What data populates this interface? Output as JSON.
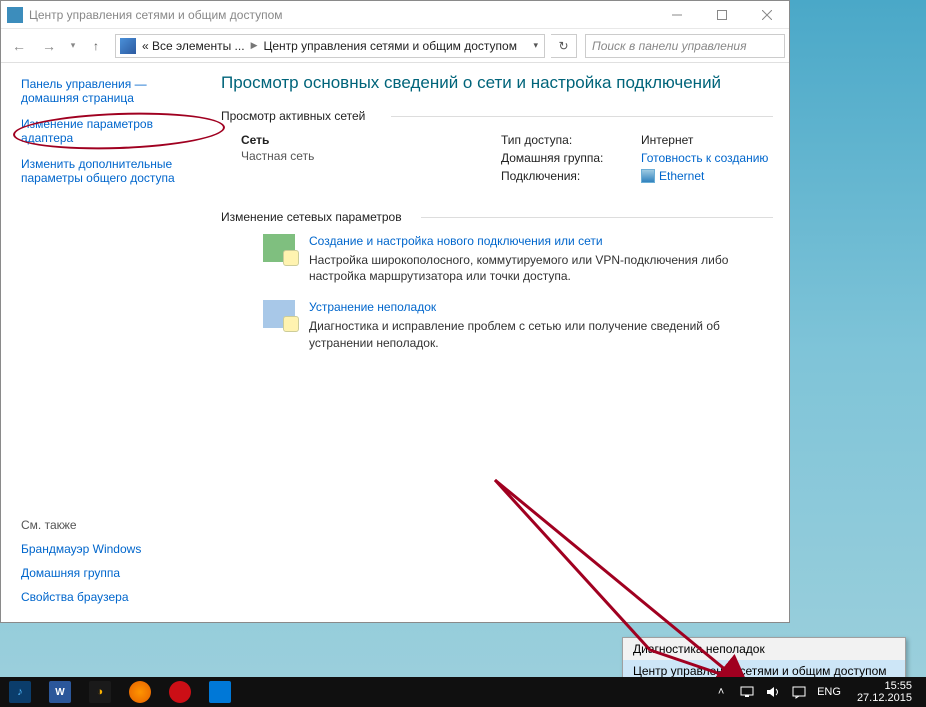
{
  "window": {
    "title": "Центр управления сетями и общим доступом"
  },
  "nav": {
    "seg1": "« Все элементы ...",
    "seg2": "Центр управления сетями и общим доступом",
    "search_placeholder": "Поиск в панели управления"
  },
  "sidebar": {
    "home": "Панель управления — домашняя страница",
    "adapter": "Изменение параметров адаптера",
    "sharing": "Изменить дополнительные параметры общего доступа",
    "seealso_h": "См. также",
    "seealso": {
      "firewall": "Брандмауэр Windows",
      "homegroup": "Домашняя группа",
      "browser": "Свойства браузера"
    }
  },
  "main": {
    "heading": "Просмотр основных сведений о сети и настройка подключений",
    "active_title": "Просмотр активных сетей",
    "net": {
      "name": "Сеть",
      "type": "Частная сеть",
      "access_k": "Тип доступа:",
      "access_v": "Интернет",
      "hg_k": "Домашняя группа:",
      "hg_v": "Готовность к созданию",
      "conn_k": "Подключения:",
      "conn_v": "Ethernet"
    },
    "change_title": "Изменение сетевых параметров",
    "action1": {
      "title": "Создание и настройка нового подключения или сети",
      "desc": "Настройка широкополосного, коммутируемого или VPN-подключения либо настройка маршрутизатора или точки доступа."
    },
    "action2": {
      "title": "Устранение неполадок",
      "desc": "Диагностика и исправление проблем с сетью или получение сведений об устранении неполадок."
    }
  },
  "ctxmenu": {
    "item1": "Диагностика неполадок",
    "item2": "Центр управления сетями и общим доступом"
  },
  "tray": {
    "lang": "ENG",
    "time": "15:55",
    "date": "27.12.2015"
  }
}
